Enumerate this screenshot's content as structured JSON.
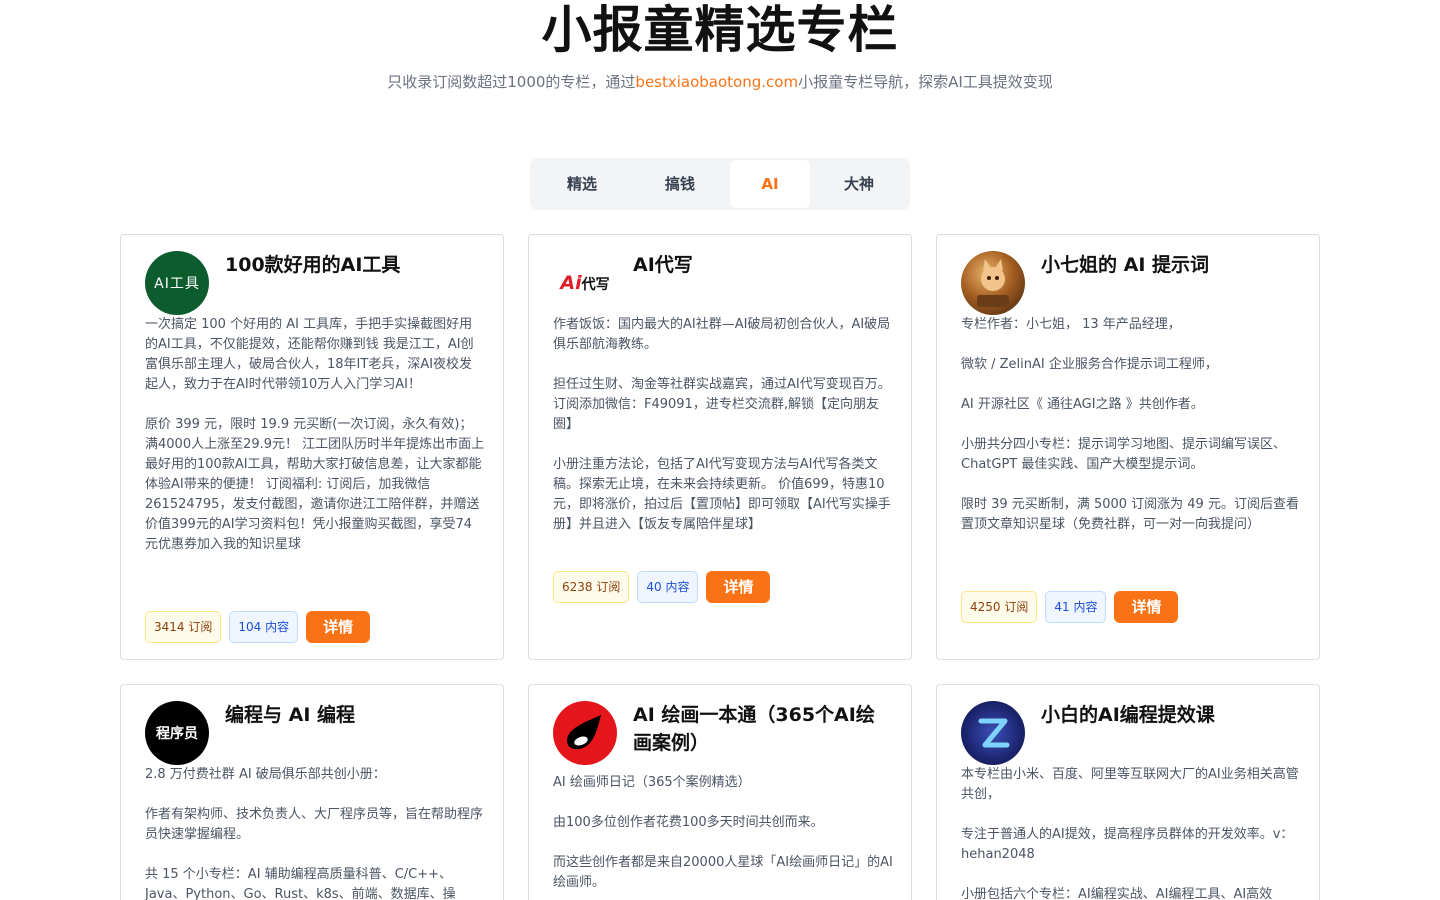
{
  "header": {
    "title": "小报童精选专栏",
    "subtitle_prefix": "只收录订阅数超过1000的专栏，通过",
    "subtitle_link": "bestxiaobaotong.com",
    "subtitle_suffix": "小报童专栏导航，探索AI工具提效变现"
  },
  "tabs": [
    {
      "label": "精选"
    },
    {
      "label": "搞钱"
    },
    {
      "label": "AI",
      "active": true
    },
    {
      "label": "大神"
    }
  ],
  "cards": [
    {
      "title": "100款好用的AI工具",
      "avatar_text": "AI工具",
      "desc": [
        "一次搞定 100 个好用的 AI 工具库，手把手实操截图好用的AI工具，不仅能提效，还能帮你赚到钱 我是江工，AI创富俱乐部主理人，破局合伙人，18年IT老兵，深AI夜校发起人，致力于在AI时代带领10万人入门学习AI！",
        "原价 399 元，限时 19.9 元买断(一次订阅，永久有效)；满4000人上涨至29.9元！ 江工团队历时半年提炼出市面上最好用的100款AI工具，帮助大家打破信息差，让大家都能体验AI带来的便捷！ 订阅福利: 订阅后，加我微信261524795，发支付截图，邀请你进江工陪伴群，并赠送价值399元的AI学习资料包！凭小报童购买截图，享受74元优惠券加入我的知识星球"
      ],
      "subs": "3414 订阅",
      "count": "104 内容",
      "button": "详情"
    },
    {
      "title": "AI代写",
      "avatar_text_ai": "Ai",
      "avatar_text_rest": "代写",
      "desc": [
        "作者饭饭：国内最大的AI社群—AI破局初创合伙人，AI破局俱乐部航海教练。",
        "担任过生财、淘金等社群实战嘉宾，通过AI代写变现百万。 订阅添加微信：F49091，进专栏交流群,解锁【定向朋友圈】",
        "小册注重方法论，包括了AI代写变现方法与AI代写各类文稿。探索无止境，在未来会持续更新。 价值699，特惠10元，即将涨价，拍过后【置顶帖】即可领取【AI代写实操手册】并且进入【饭友专属陪伴星球】"
      ],
      "subs": "6238 订阅",
      "count": "40 内容",
      "button": "详情"
    },
    {
      "title": "小七姐的 AI 提示词",
      "desc": [
        "专栏作者：小七姐， 13 年产品经理，",
        "微软 / ZelinAI 企业服务合作提示词工程师，",
        "AI 开源社区《 通往AGI之路 》共创作者。",
        "小册共分四小专栏：提示词学习地图、提示词编写误区、ChatGPT 最佳实践、国产大模型提示词。",
        "限时 39 元买断制，满 5000 订阅涨为 49 元。订阅后查看置顶文章知识星球（免费社群，可一对一向我提问）"
      ],
      "subs": "4250 订阅",
      "count": "41 内容",
      "button": "详情"
    },
    {
      "title": "编程与 AI 编程",
      "avatar_text": "程序员",
      "desc": [
        "2.8 万付费社群 AI 破局俱乐部共创小册：",
        "作者有架构师、技术负责人、大厂程序员等，旨在帮助程序员快速掌握编程。",
        "共 15 个小专栏：AI 辅助编程高质量科普、C/C++、Java、Python、Go、Rust、k8s、前端、数据库、操"
      ]
    },
    {
      "title": "AI 绘画一本通（365个AI绘画案例）",
      "desc": [
        "AI 绘画师日记（365个案例精选）",
        "由100多位创作者花费100多天时间共创而来。",
        "而这些创作者都是来自20000人星球「AI绘画师日记」的AI绘画师。"
      ]
    },
    {
      "title": "小白的AI编程提效课",
      "desc": [
        "本专栏由小米、百度、阿里等互联网大厂的AI业务相关高管共创，",
        "专注于普通人的AI提效，提高程序员群体的开发效率。v：hehan2048",
        "小册包括六个专栏：AI编程实战、AI编程工具、AI高效"
      ]
    }
  ],
  "colors": {
    "accent": "#f97316",
    "card_border": "#d9dbe0",
    "tab_bg": "#f3f4f6"
  }
}
